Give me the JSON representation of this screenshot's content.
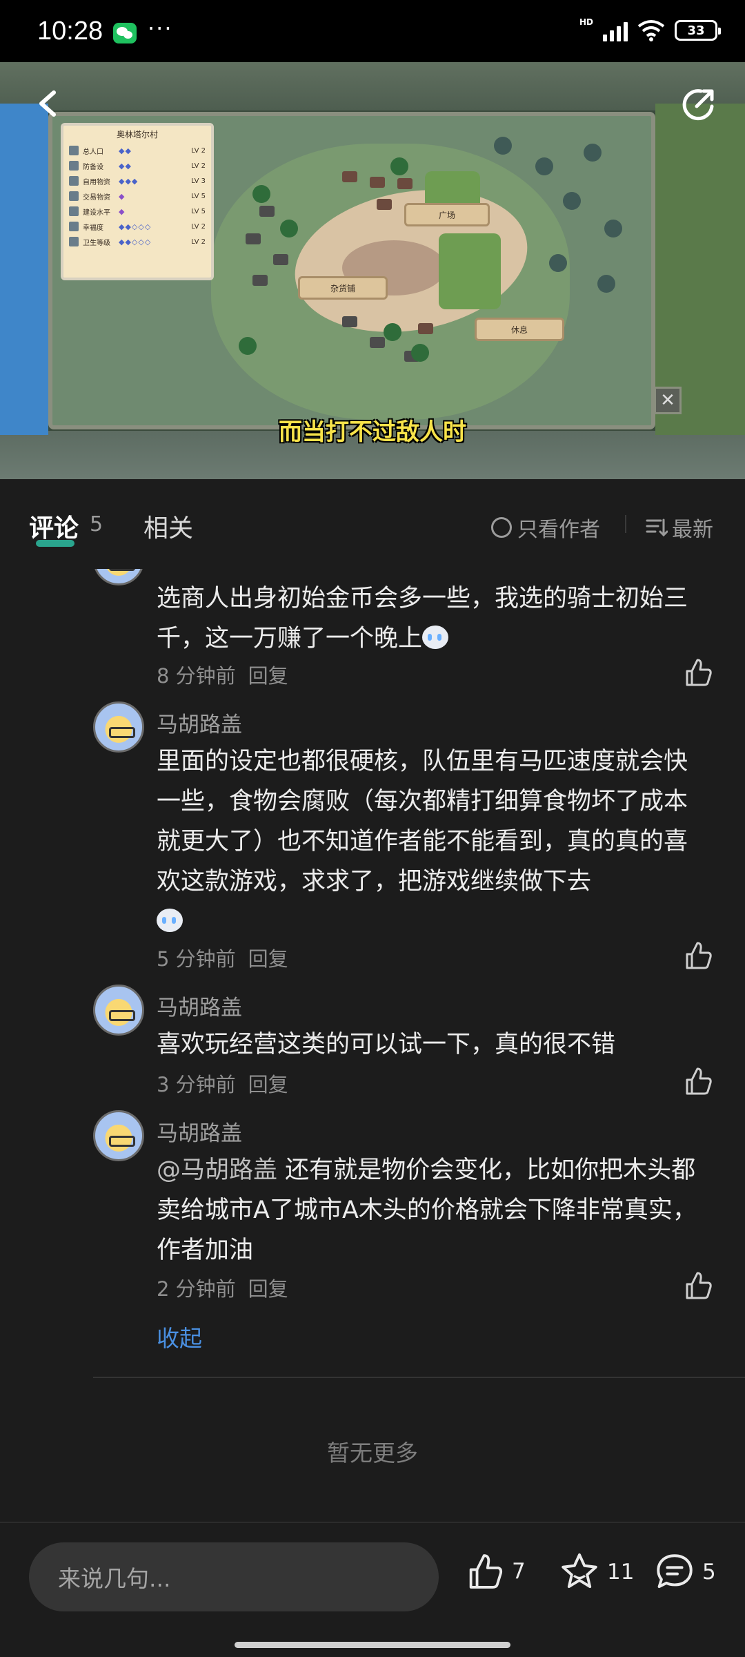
{
  "status_bar": {
    "time": "10:28",
    "dots": "···",
    "hd": "HD",
    "battery": "33"
  },
  "video": {
    "subtitle": "而当打不过敌人时",
    "panel_title": "奥林塔尔村",
    "stats": [
      {
        "name": "总人口",
        "level": "LV 2"
      },
      {
        "name": "防备设",
        "level": "LV 2"
      },
      {
        "name": "自用物资",
        "level": "LV 3"
      },
      {
        "name": "交易物资",
        "level": "LV 5"
      },
      {
        "name": "建设水平",
        "level": "LV 5"
      },
      {
        "name": "幸福度",
        "level": "LV 2"
      },
      {
        "name": "卫生等级",
        "level": "LV 2"
      }
    ],
    "tags": {
      "plaza": "广场",
      "store": "杂货铺",
      "rest": "休息"
    },
    "close_symbol": "✕"
  },
  "tabs": {
    "comments_label": "评论",
    "comments_count": "5",
    "related_label": "相关",
    "author_only": "只看作者",
    "latest": "最新"
  },
  "comments": [
    {
      "text": "选商人出身初始金币会多一些，我选的骑士初始三千，这一万赚了一个晚上",
      "time": "8 分钟前",
      "reply": "回复"
    },
    {
      "name": "马胡路盖",
      "text": "里面的设定也都很硬核，队伍里有马匹速度就会快一些，食物会腐败（每次都精打细算食物坏了成本就更大了）也不知道作者能不能看到，真的真的喜欢这款游戏，求求了，把游戏继续做下去",
      "time": "5 分钟前",
      "reply": "回复"
    },
    {
      "name": "马胡路盖",
      "text": "喜欢玩经营这类的可以试一下，真的很不错",
      "time": "3 分钟前",
      "reply": "回复"
    },
    {
      "name": "马胡路盖",
      "mention": "@马胡路盖",
      "text": "还有就是物价会变化，比如你把木头都卖给城市A了城市A木头的价格就会下降非常真实，作者加油",
      "time": "2 分钟前",
      "reply": "回复"
    }
  ],
  "collapse_label": "收起",
  "no_more": "暂无更多",
  "bottom_bar": {
    "input_placeholder": "来说几句...",
    "likes": "7",
    "favorites": "11",
    "comments": "5"
  }
}
